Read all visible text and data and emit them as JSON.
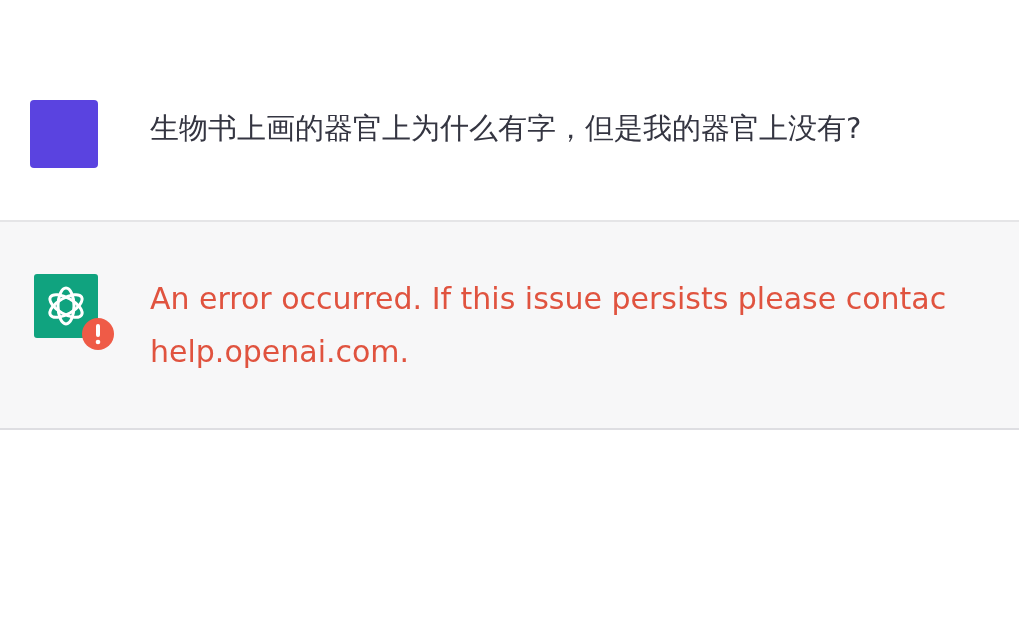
{
  "messages": [
    {
      "kind": "user",
      "text": "生物书上画的器官上为什么有字，但是我的器官上没有?"
    },
    {
      "kind": "error",
      "lines": [
        "An error occurred. If this issue persists please contac",
        "help.openai.com."
      ]
    }
  ]
}
